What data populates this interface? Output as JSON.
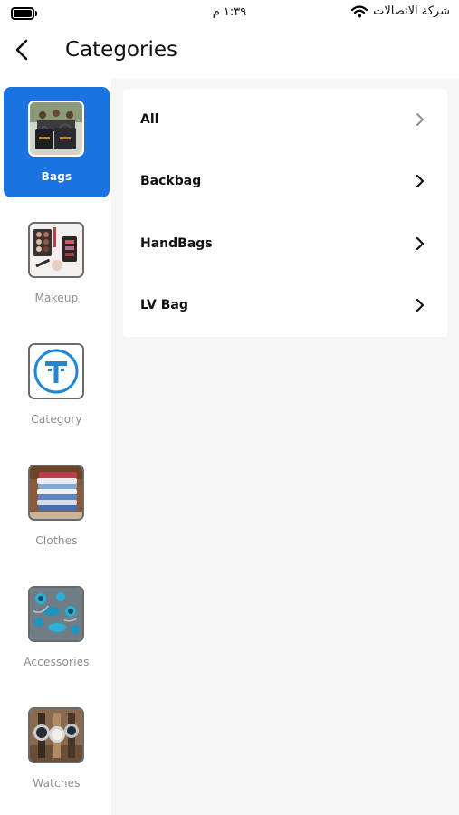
{
  "status_bar": {
    "time": "١:٣٩ م",
    "carrier": "شركة الاتصالات"
  },
  "header": {
    "title": "Categories"
  },
  "sidebar": {
    "items": [
      {
        "label": "Bags",
        "icon": "bags-thumbnail",
        "active": true
      },
      {
        "label": "Makeup",
        "icon": "makeup-thumbnail",
        "active": false
      },
      {
        "label": "Category",
        "icon": "category-logo-thumbnail",
        "active": false
      },
      {
        "label": "Clothes",
        "icon": "clothes-thumbnail",
        "active": false
      },
      {
        "label": "Accessories",
        "icon": "accessories-thumbnail",
        "active": false
      },
      {
        "label": "Watches",
        "icon": "watches-thumbnail",
        "active": false
      }
    ]
  },
  "subcategories": [
    {
      "label": "All"
    },
    {
      "label": "Backbag"
    },
    {
      "label": "HandBags"
    },
    {
      "label": "LV Bag"
    }
  ],
  "colors": {
    "accent": "#1a73e0",
    "content_background": "#f6f6f6"
  }
}
